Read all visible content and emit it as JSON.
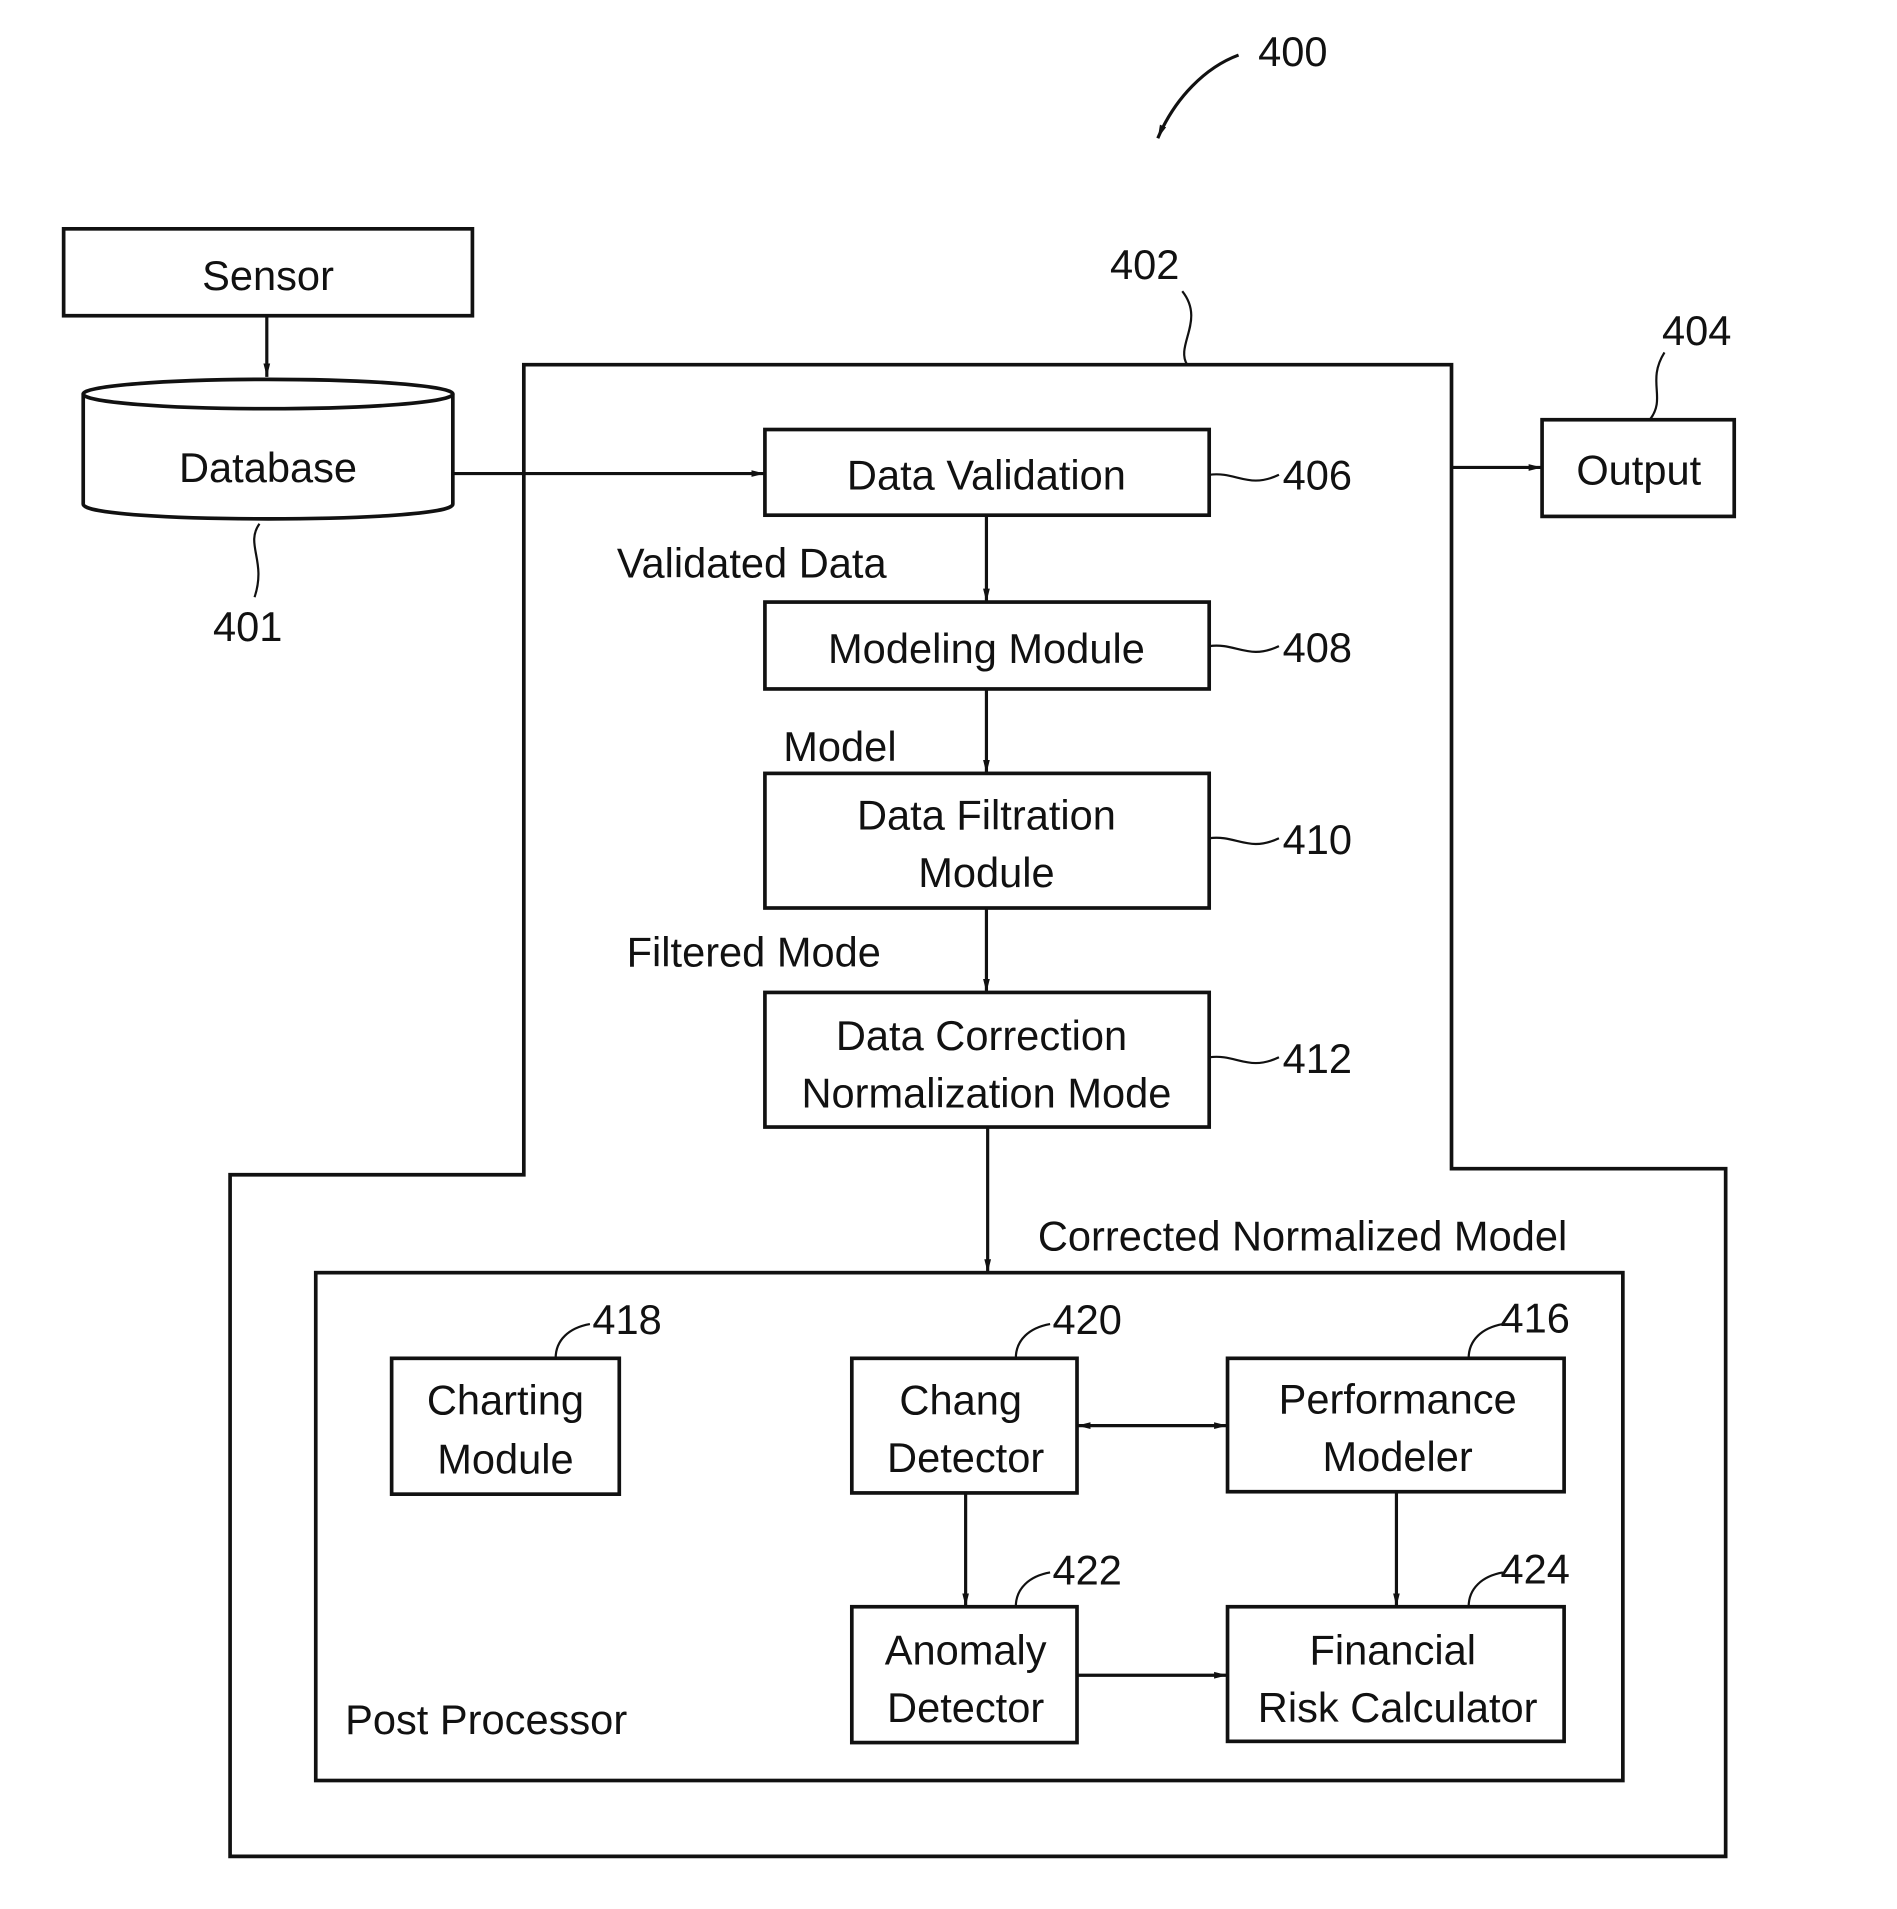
{
  "figure": {
    "ref": "400",
    "colors": {
      "ink": "#111111",
      "background": "#ffffff"
    }
  },
  "sensor": {
    "label": "Sensor"
  },
  "database": {
    "label": "Database",
    "ref": "401"
  },
  "processor": {
    "ref": "402"
  },
  "output": {
    "label": "Output",
    "ref": "404"
  },
  "pipeline": {
    "data_validation": {
      "label": "Data Validation",
      "ref": "406"
    },
    "modeling_module": {
      "label": "Modeling Module",
      "ref": "408"
    },
    "data_filtration": {
      "line1": "Data Filtration",
      "line2": "Module",
      "ref": "410"
    },
    "data_correction": {
      "line1": "Data Correction",
      "line2": "Normalization Mode",
      "ref": "412"
    }
  },
  "flow_labels": {
    "validated_data": "Validated Data",
    "model": "Model",
    "filtered_mode": "Filtered Mode",
    "corrected_normalized_model": "Corrected Normalized Model"
  },
  "post_processor": {
    "label": "Post Processor",
    "charting_module": {
      "line1": "Charting",
      "line2": "Module",
      "ref": "418"
    },
    "chang_detector": {
      "line1": "Chang",
      "line2": "Detector",
      "ref": "420"
    },
    "performance_modeler": {
      "line1": "Performance",
      "line2": "Modeler",
      "ref": "416"
    },
    "anomaly_detector": {
      "line1": "Anomaly",
      "line2": "Detector",
      "ref": "422"
    },
    "financial_risk_calculator": {
      "line1": "Financial",
      "line2": "Risk Calculator",
      "ref": "424"
    }
  }
}
